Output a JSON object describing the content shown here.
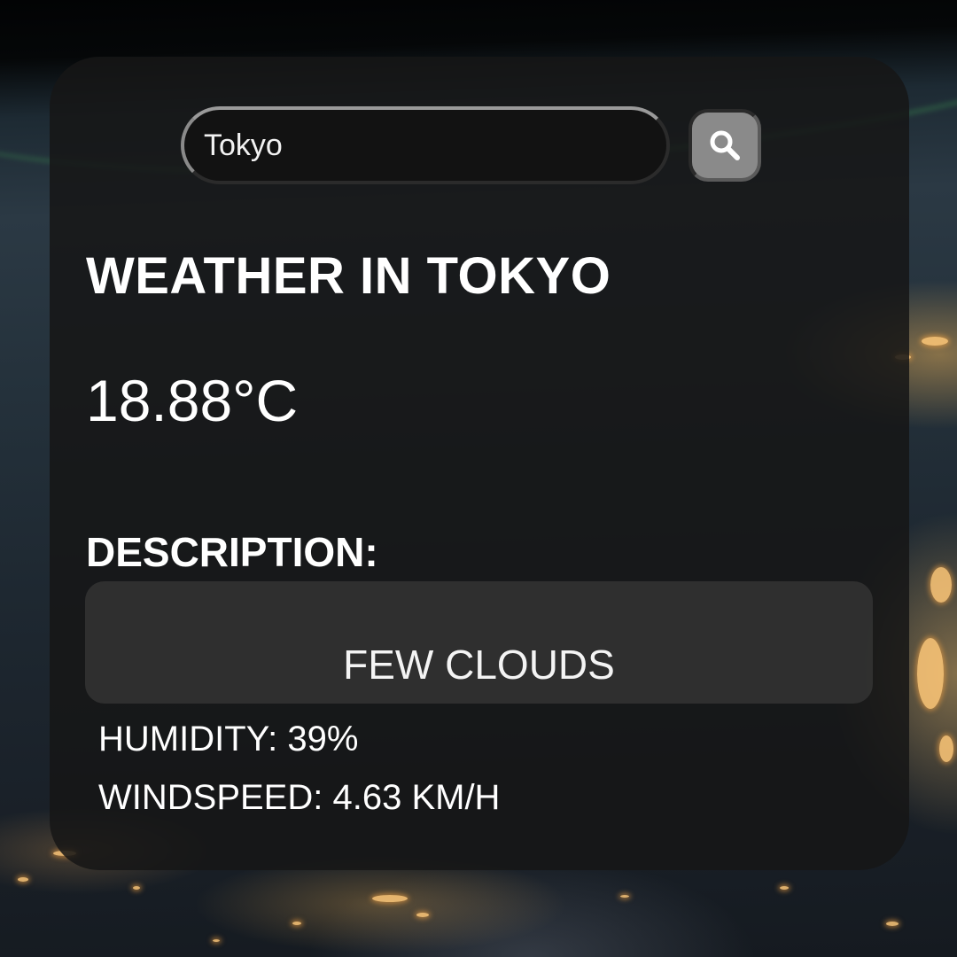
{
  "search": {
    "value": "Tokyo",
    "button_icon": "search-icon"
  },
  "weather": {
    "title": "WEATHER IN TOKYO",
    "temperature": "18.88°C",
    "description_label": "DESCRIPTION:",
    "description": "FEW CLOUDS",
    "humidity": "HUMIDITY: 39%",
    "windspeed": "WINDSPEED: 4.63 KM/H"
  },
  "colors": {
    "card": "#161616",
    "text": "#ffffff",
    "search_button": "#8a8a8a"
  }
}
